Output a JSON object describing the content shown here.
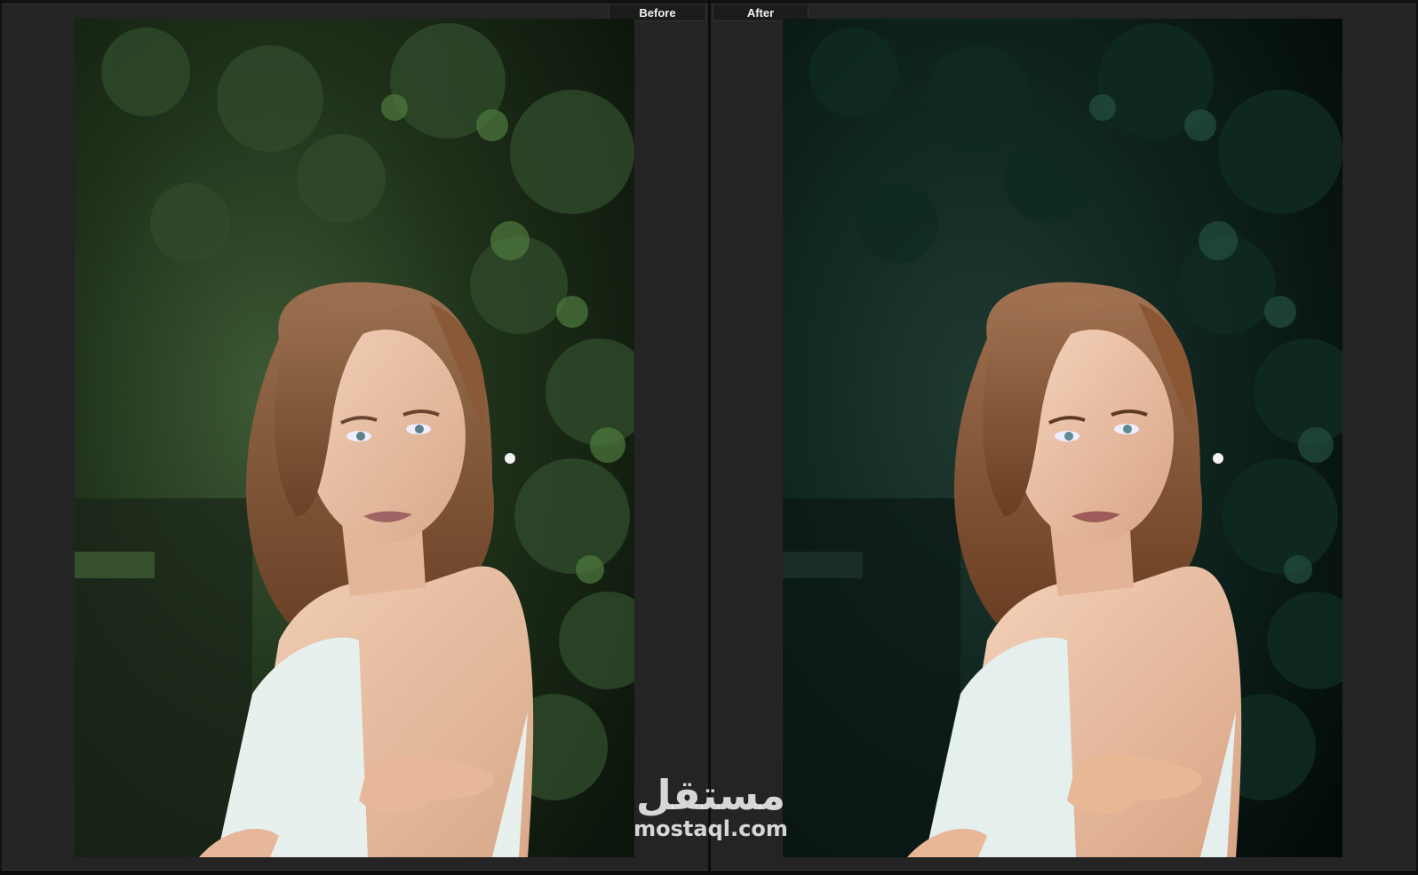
{
  "labels": {
    "before": "Before",
    "after": "After"
  },
  "watermark": {
    "logo_text": "مستقل",
    "url": "mostaql.com"
  },
  "colors": {
    "pane_background": "#242424",
    "label_text": "#f0f0f0",
    "before_foliage": "#2f4a2a",
    "after_foliage": "#0f2a22",
    "dress": "#e8f0ee",
    "skin": "#e9c3a6",
    "hair": "#8a5a38"
  }
}
